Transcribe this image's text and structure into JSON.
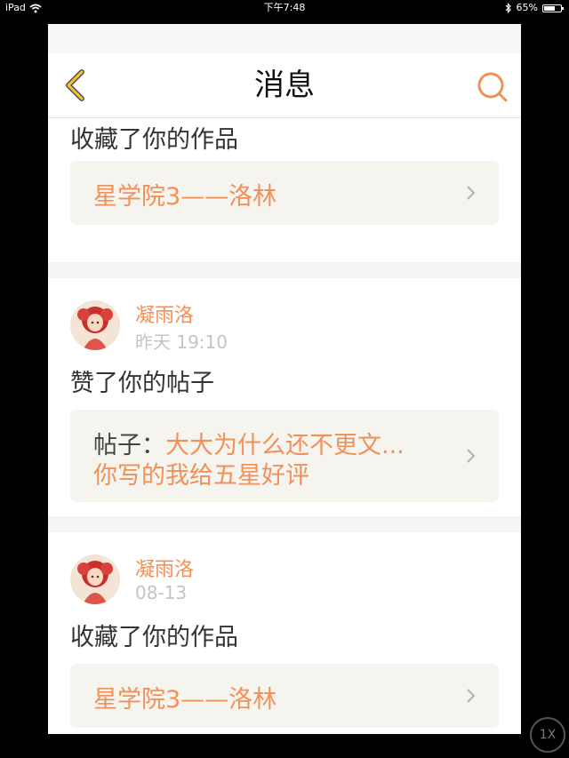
{
  "status_bar": {
    "device": "iPad",
    "time": "下午7:48",
    "battery_percent": "65%",
    "battery_level": 0.65
  },
  "nav": {
    "title": "消息",
    "back_icon": "chevron-left-icon",
    "search_icon": "search-icon"
  },
  "accent_color": "#f0915a",
  "feed": [
    {
      "action": "收藏了你的作品",
      "ref_title": "星学院3——洛林"
    },
    {
      "user": "凝雨洛",
      "time": "昨天 19:10",
      "action": "赞了你的帖子",
      "post_prefix": "帖子：",
      "post_text_line1": "大大为什么还不更文...",
      "post_text_line2": "你写的我给五星好评"
    },
    {
      "user": "凝雨洛",
      "time": "08-13",
      "action": "收藏了你的作品",
      "ref_title": "星学院3——洛林"
    }
  ],
  "zoom_label": "1X"
}
